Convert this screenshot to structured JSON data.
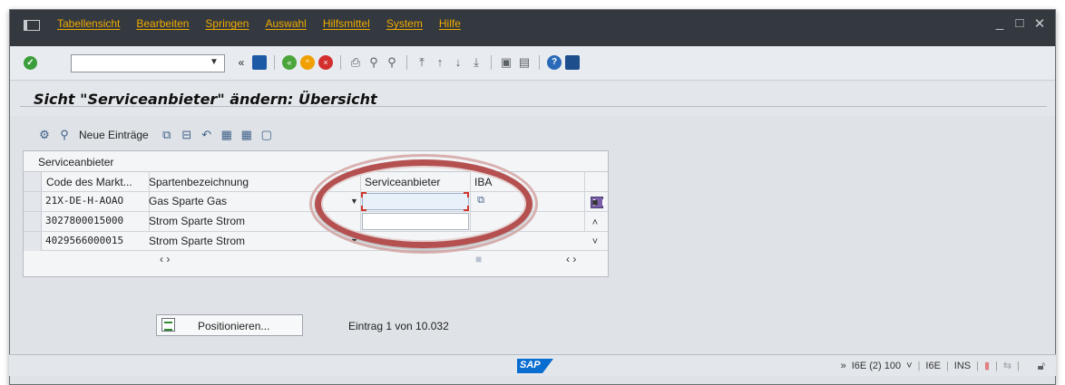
{
  "menubar": {
    "items": [
      "Tabellensicht",
      "Bearbeiten",
      "Springen",
      "Auswahl",
      "Hilfsmittel",
      "System",
      "Hilfe"
    ],
    "window_controls": [
      "_",
      "□",
      "✕"
    ]
  },
  "toolbar": {
    "command_value": "",
    "back_glyph": "«"
  },
  "header": {
    "title": "Sicht \"Serviceanbieter\" ändern: Übersicht"
  },
  "app_toolbar": {
    "new_entries_label": "Neue Einträge"
  },
  "table": {
    "caption": "Serviceanbieter",
    "columns": [
      "Code des Markt...",
      "Spartenbezeichnung",
      "Serviceanbieter",
      "IBA"
    ],
    "rows": [
      {
        "code": "21X-DE-H-AOAO",
        "sparte": "Gas Sparte Gas",
        "serviceanbieter": ""
      },
      {
        "code": "3027800015000",
        "sparte": "Strom Sparte Strom",
        "serviceanbieter": ""
      },
      {
        "code": "4029566000015",
        "sparte": "Strom Sparte Strom",
        "serviceanbieter": ""
      }
    ],
    "hscroll_left": "‹ ›",
    "hscroll_right": "‹ ›"
  },
  "bottom": {
    "position_button_label": "Positionieren...",
    "entry_info": "Eintrag 1 von 10.032"
  },
  "statusbar": {
    "logo": "SAP",
    "expand": "»",
    "system": "I6E (2) 100",
    "system_dropdown": "˅",
    "server": "I6E",
    "mode": "INS"
  },
  "colors": {
    "menubar_bg": "#34393f",
    "menu_text": "#f0ab00",
    "highlight_ring": "#b55050",
    "sap_blue": "#0a6ed1"
  }
}
